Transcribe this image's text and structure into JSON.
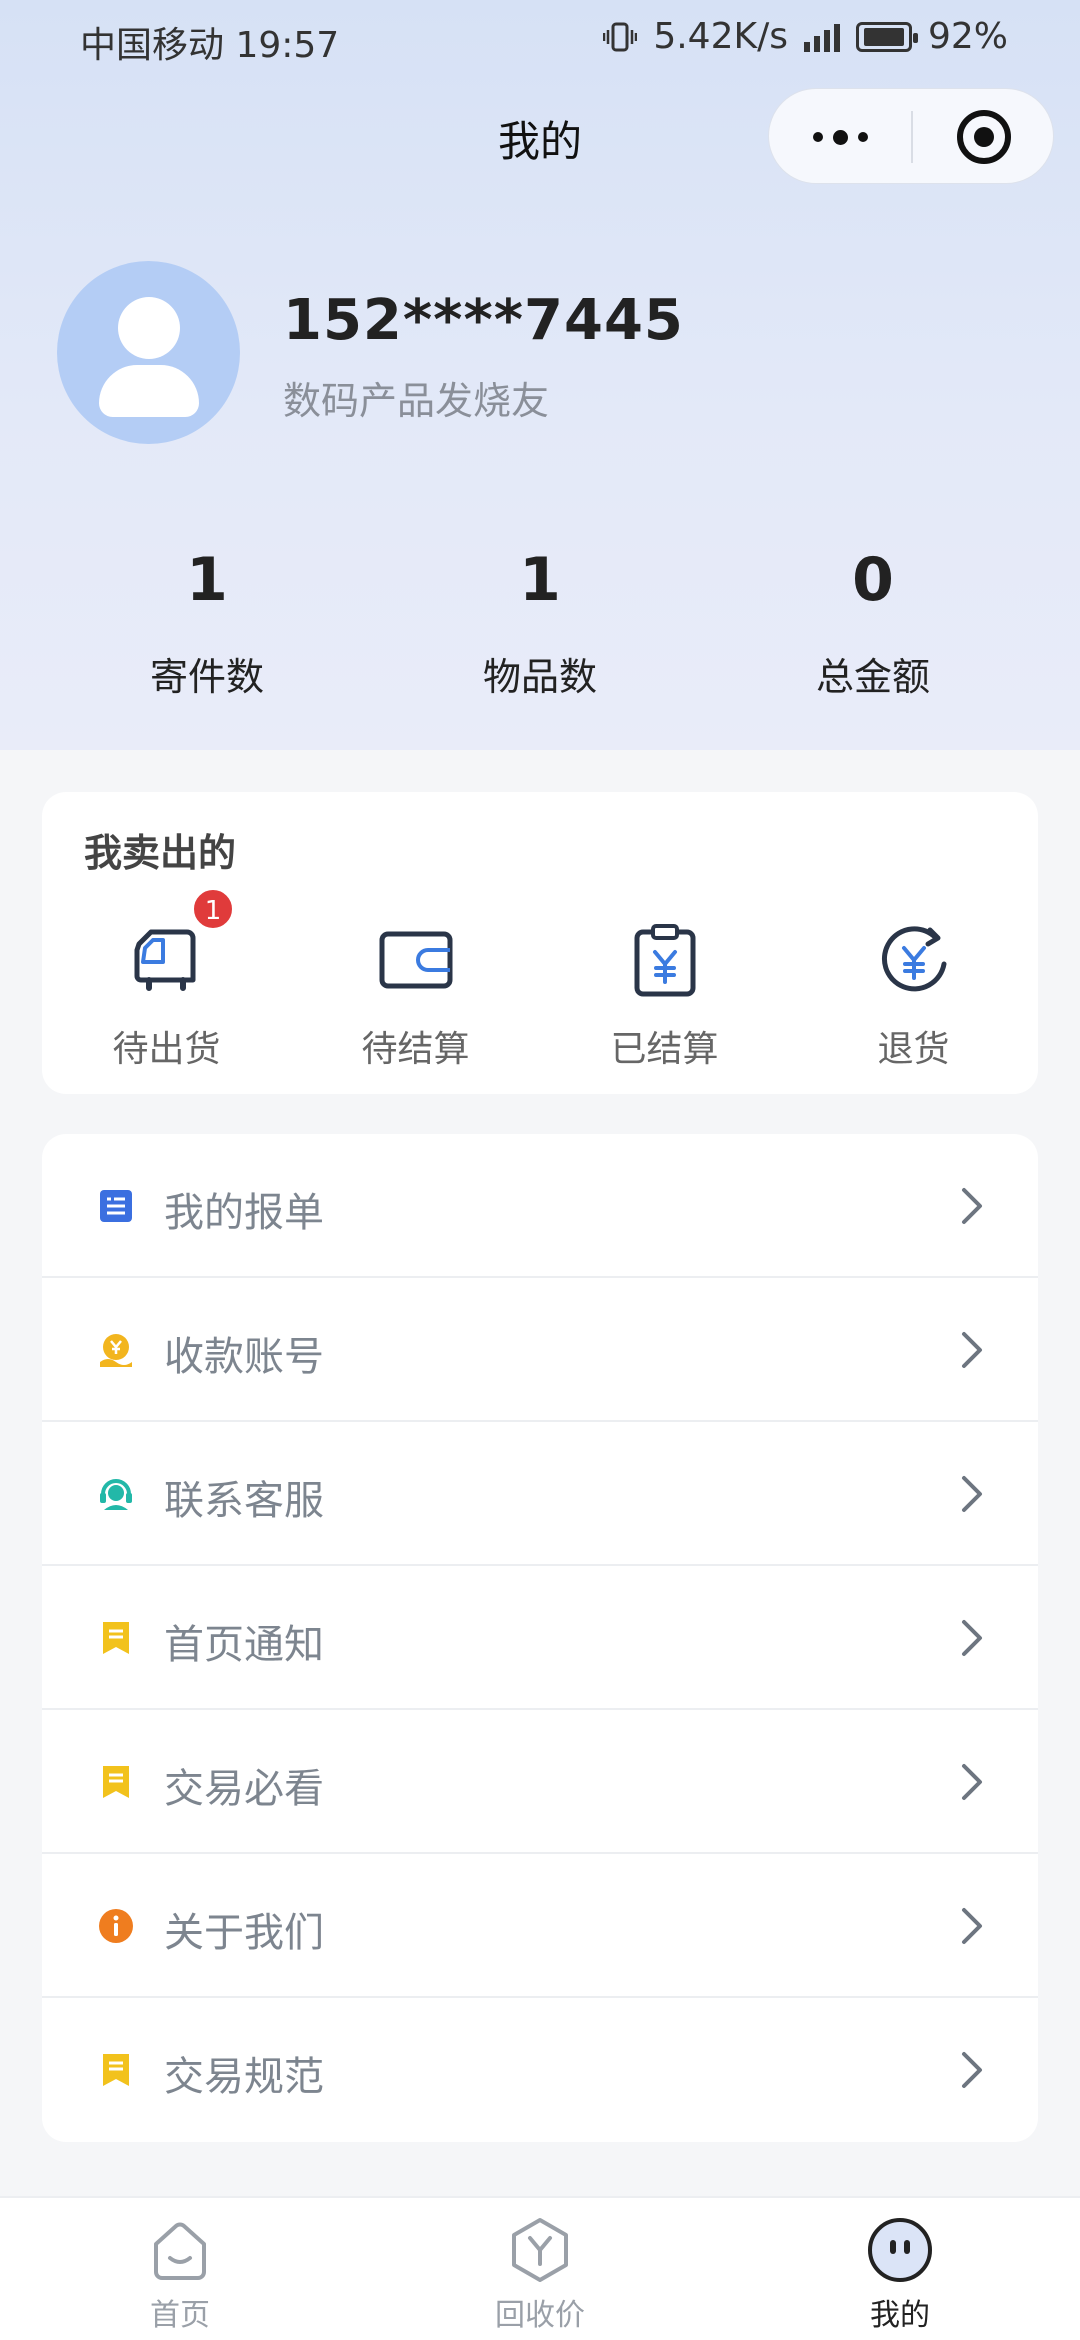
{
  "status_bar": {
    "carrier_time": "中国移动 19:57",
    "speed": "5.42K/s",
    "battery": "92%",
    "icons": [
      "vibrate-icon",
      "signal-4g-icon",
      "battery-charging-icon"
    ]
  },
  "nav": {
    "title": "我的",
    "icons": [
      "more-dots-icon",
      "close-target-icon"
    ]
  },
  "profile": {
    "phone": "152****7445",
    "tag": "数码产品发烧友",
    "avatar_icon": "user-avatar-icon"
  },
  "stats": [
    {
      "value": "1",
      "label": "寄件数"
    },
    {
      "value": "1",
      "label": "物品数"
    },
    {
      "value": "0",
      "label": "总金额"
    }
  ],
  "sold": {
    "title": "我卖出的",
    "items": [
      {
        "label": "待出货",
        "icon": "truck-icon",
        "badge": "1"
      },
      {
        "label": "待结算",
        "icon": "wallet-icon"
      },
      {
        "label": "已结算",
        "icon": "clipboard-yen-icon"
      },
      {
        "label": "退货",
        "icon": "yen-return-icon"
      }
    ]
  },
  "menu": [
    {
      "label": "我的报单",
      "icon": "form-icon",
      "color": "#3b6fe0"
    },
    {
      "label": "收款账号",
      "icon": "yen-hand-icon",
      "color": "#f2b51e"
    },
    {
      "label": "联系客服",
      "icon": "headset-icon",
      "color": "#22b8a8"
    },
    {
      "label": "首页通知",
      "icon": "note-icon",
      "color": "#f2c21c"
    },
    {
      "label": "交易必看",
      "icon": "note-icon",
      "color": "#f2c21c"
    },
    {
      "label": "关于我们",
      "icon": "info-icon",
      "color": "#ef7d1f"
    },
    {
      "label": "交易规范",
      "icon": "note-icon",
      "color": "#f2c21c"
    }
  ],
  "tabbar": [
    {
      "label": "首页",
      "icon": "home-face-icon",
      "active": false
    },
    {
      "label": "回收价",
      "icon": "yen-hexagon-icon",
      "active": false
    },
    {
      "label": "我的",
      "icon": "mine-face-icon",
      "active": true
    }
  ]
}
